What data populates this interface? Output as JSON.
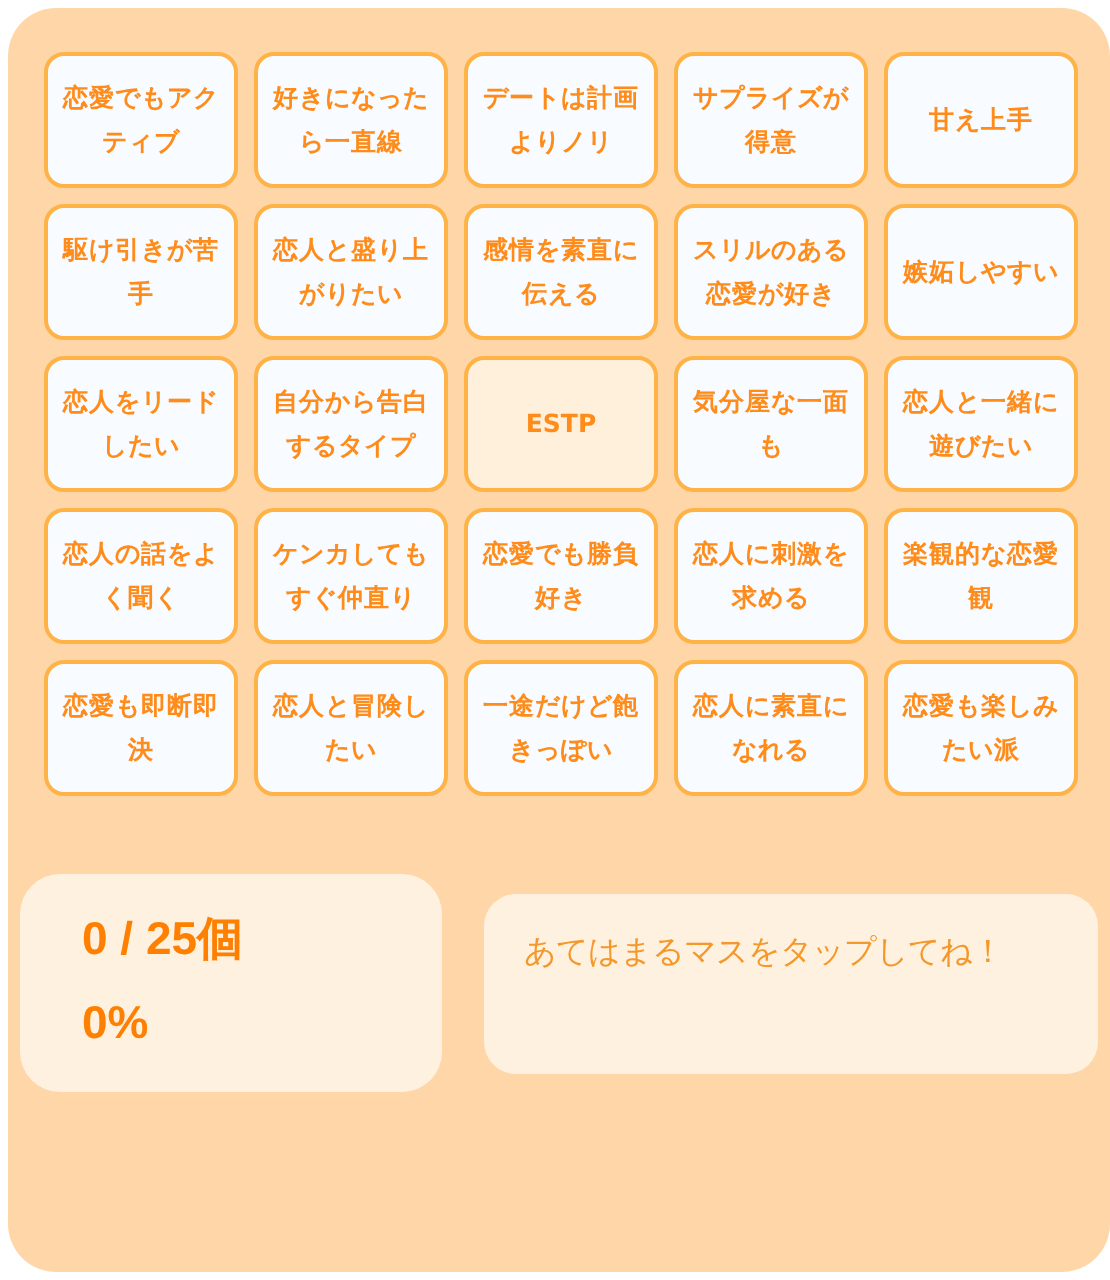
{
  "cells": [
    {
      "label": "恋愛でもアクティブ",
      "kind": "normal",
      "selected": false
    },
    {
      "label": "好きになったら一直線",
      "kind": "normal",
      "selected": false
    },
    {
      "label": "デートは計画よりノリ",
      "kind": "normal",
      "selected": false
    },
    {
      "label": "サプライズが得意",
      "kind": "normal",
      "selected": false
    },
    {
      "label": "甘え上手",
      "kind": "normal",
      "selected": false
    },
    {
      "label": "駆け引きが苦手",
      "kind": "normal",
      "selected": false
    },
    {
      "label": "恋人と盛り上がりたい",
      "kind": "normal",
      "selected": false
    },
    {
      "label": "感情を素直に伝える",
      "kind": "normal",
      "selected": false
    },
    {
      "label": "スリルのある恋愛が好き",
      "kind": "normal",
      "selected": false
    },
    {
      "label": "嫉妬しやすい",
      "kind": "normal",
      "selected": false
    },
    {
      "label": "恋人をリードしたい",
      "kind": "normal",
      "selected": false
    },
    {
      "label": "自分から告白するタイプ",
      "kind": "normal",
      "selected": false
    },
    {
      "label": "ESTP",
      "kind": "free",
      "selected": false
    },
    {
      "label": "気分屋な一面も",
      "kind": "normal",
      "selected": false
    },
    {
      "label": "恋人と一緒に遊びたい",
      "kind": "normal",
      "selected": false
    },
    {
      "label": "恋人の話をよく聞く",
      "kind": "normal",
      "selected": false
    },
    {
      "label": "ケンカしてもすぐ仲直り",
      "kind": "normal",
      "selected": false
    },
    {
      "label": "恋愛でも勝負好き",
      "kind": "normal",
      "selected": false
    },
    {
      "label": "恋人に刺激を求める",
      "kind": "normal",
      "selected": false
    },
    {
      "label": "楽観的な恋愛観",
      "kind": "normal",
      "selected": false
    },
    {
      "label": "恋愛も即断即決",
      "kind": "normal",
      "selected": false
    },
    {
      "label": "恋人と冒険したい",
      "kind": "normal",
      "selected": false
    },
    {
      "label": "一途だけど飽きっぽい",
      "kind": "normal",
      "selected": false
    },
    {
      "label": "恋人に素直になれる",
      "kind": "normal",
      "selected": false
    },
    {
      "label": "恋愛も楽しみたい派",
      "kind": "normal",
      "selected": false
    }
  ],
  "score": {
    "count": "0 / 25個",
    "percent": "0%"
  },
  "message": "あてはまるマスをタップしてね！"
}
